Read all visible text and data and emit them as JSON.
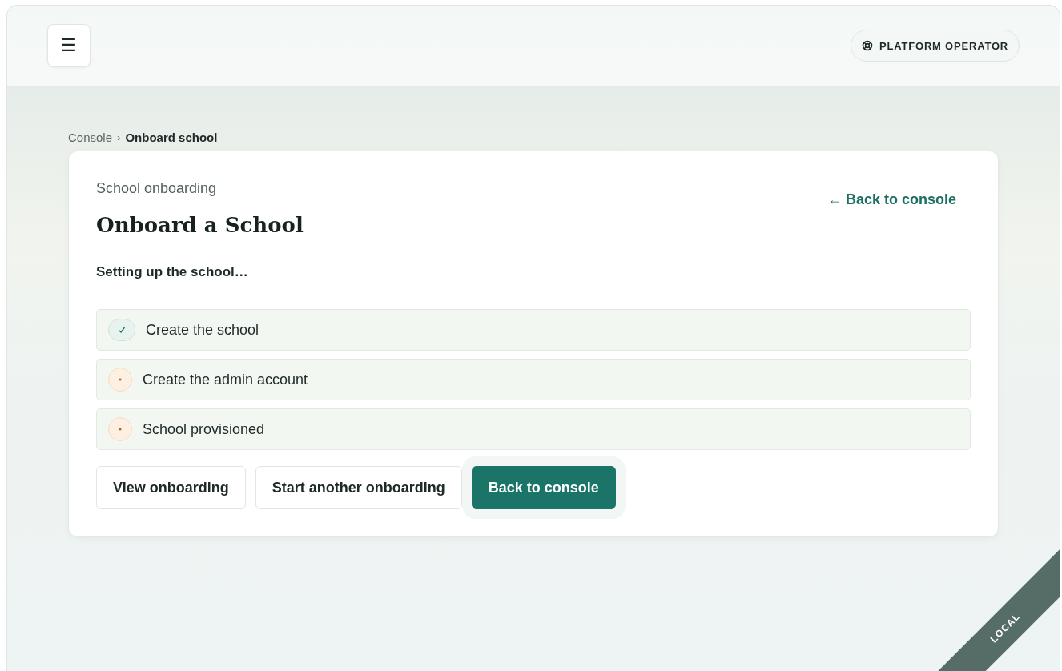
{
  "header": {
    "menu_button": "☰",
    "role_badge": "PLATFORM OPERATOR"
  },
  "breadcrumb": {
    "items": [
      "Console",
      "Onboard school"
    ],
    "separator": "›"
  },
  "card": {
    "eyebrow": "School onboarding",
    "title": "Onboard a School",
    "back_link": "← Back to console",
    "status_text": "Setting up the school…",
    "steps": [
      {
        "label": "Create the school",
        "kind": "done"
      },
      {
        "label": "Create the admin account",
        "kind": "pending"
      },
      {
        "label": "School provisioned",
        "kind": "pending"
      }
    ],
    "buttons": [
      {
        "label": "View onboarding",
        "kind": "secondary"
      },
      {
        "label": "Start another onboarding",
        "kind": "secondary"
      },
      {
        "label": "Back to console",
        "kind": "primary"
      }
    ]
  },
  "environment_ribbon": "LOCAL"
}
